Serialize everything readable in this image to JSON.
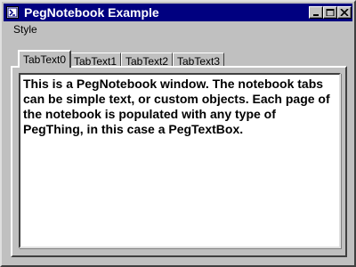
{
  "window": {
    "title": "PegNotebook Example",
    "icon": "app-icon",
    "controls": [
      "minimize-icon",
      "maximize-icon",
      "close-icon"
    ]
  },
  "menubar": {
    "items": [
      {
        "label": "Style"
      }
    ]
  },
  "notebook": {
    "tabs": [
      {
        "label": "TabText0",
        "active": true
      },
      {
        "label": "TabText1",
        "active": false
      },
      {
        "label": "TabText2",
        "active": false
      },
      {
        "label": "TabText3",
        "active": false
      }
    ],
    "page_text": "This is a PegNotebook window. The notebook tabs can be simple text, or custom objects. Each page of the notebook is populated with any type of PegThing, in this case a PegTextBox."
  },
  "colors": {
    "titlebar": "#000080",
    "face": "#c0c0c0",
    "textbox_bg": "#ffffff"
  }
}
